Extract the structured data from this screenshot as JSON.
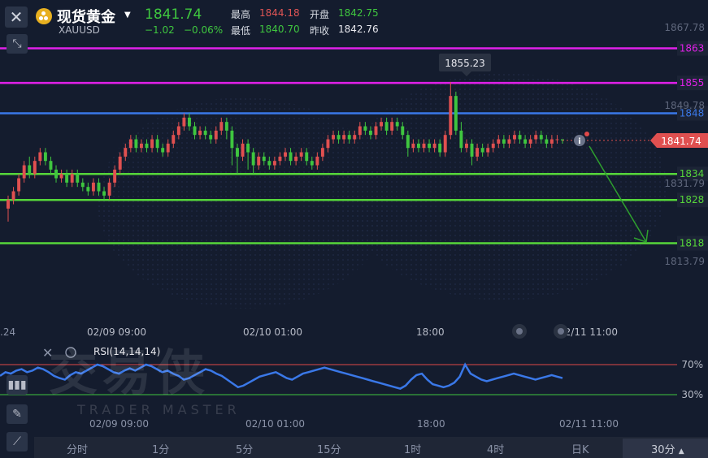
{
  "header": {
    "title": "现货黄金",
    "symbol": "XAUUSD",
    "price": "1841.74",
    "change": "−1.02",
    "change_pct": "−0.06%",
    "high_label": "最高",
    "high_value": "1844.18",
    "low_label": "最低",
    "low_value": "1840.70",
    "open_label": "开盘",
    "open_value": "1842.75",
    "prev_close_label": "昨收",
    "prev_close_value": "1842.76"
  },
  "toolbar": {
    "close_icon": "close-icon",
    "expand_icon": "expand-icon",
    "indicator_icon": "indicator-icon",
    "draw_icon": "pencil-icon",
    "line_icon": "line-tool-icon"
  },
  "watermark": {
    "main": "交易侠",
    "sub": "TRADER MASTER"
  },
  "chart_data": {
    "type": "candlestick",
    "axis_labels": [
      "1867.78",
      "1849.78",
      "1831.79",
      "1813.79"
    ],
    "peak_label": "1855.23",
    "current_price_label": "1841.74",
    "x_labels": [
      "02/09 09:00",
      "02/10 01:00",
      "18:00",
      "02/11 11:00"
    ],
    "left_edge_label": ".24",
    "hlines": [
      {
        "value": 1863,
        "label": "1863",
        "color": "#e020e8"
      },
      {
        "value": 1855,
        "label": "1855",
        "color": "#e020e8"
      },
      {
        "value": 1848,
        "label": "1848",
        "color": "#3a78e8"
      },
      {
        "value": 1834,
        "label": "1834",
        "color": "#56d63a"
      },
      {
        "value": 1828,
        "label": "1828",
        "color": "#56d63a"
      },
      {
        "value": 1818,
        "label": "1818",
        "color": "#56d63a"
      }
    ],
    "candles": [
      [
        1826,
        1828,
        1823,
        1829
      ],
      [
        1828,
        1830,
        1827,
        1831
      ],
      [
        1830,
        1833,
        1829,
        1834
      ],
      [
        1833,
        1836,
        1832,
        1837
      ],
      [
        1836,
        1834,
        1833,
        1838
      ],
      [
        1834,
        1837,
        1833,
        1838
      ],
      [
        1837,
        1839,
        1836,
        1840
      ],
      [
        1839,
        1837,
        1836,
        1840
      ],
      [
        1837,
        1835,
        1834,
        1838
      ],
      [
        1835,
        1833,
        1832,
        1836
      ],
      [
        1833,
        1834,
        1832,
        1835
      ],
      [
        1834,
        1832,
        1831,
        1835
      ],
      [
        1832,
        1834,
        1831,
        1835
      ],
      [
        1834,
        1832,
        1831,
        1835
      ],
      [
        1832,
        1831,
        1830,
        1833
      ],
      [
        1831,
        1830,
        1829,
        1832
      ],
      [
        1830,
        1832,
        1829,
        1833
      ],
      [
        1832,
        1830,
        1829,
        1833
      ],
      [
        1830,
        1829,
        1828,
        1831
      ],
      [
        1829,
        1832,
        1828,
        1833
      ],
      [
        1832,
        1835,
        1831,
        1836
      ],
      [
        1835,
        1838,
        1834,
        1839
      ],
      [
        1838,
        1840,
        1837,
        1841
      ],
      [
        1840,
        1842,
        1839,
        1843
      ],
      [
        1842,
        1840,
        1839,
        1843
      ],
      [
        1840,
        1841,
        1839,
        1842
      ],
      [
        1841,
        1840,
        1839,
        1842
      ],
      [
        1840,
        1842,
        1839,
        1843
      ],
      [
        1842,
        1840,
        1839,
        1843
      ],
      [
        1840,
        1839,
        1838,
        1841
      ],
      [
        1839,
        1841,
        1838,
        1842
      ],
      [
        1841,
        1843,
        1840,
        1844
      ],
      [
        1843,
        1845,
        1842,
        1846
      ],
      [
        1845,
        1847,
        1844,
        1848
      ],
      [
        1847,
        1845,
        1844,
        1848
      ],
      [
        1845,
        1843,
        1842,
        1846
      ],
      [
        1843,
        1844,
        1842,
        1845
      ],
      [
        1844,
        1843,
        1842,
        1845
      ],
      [
        1843,
        1842,
        1841,
        1844
      ],
      [
        1842,
        1844,
        1841,
        1845
      ],
      [
        1844,
        1846,
        1843,
        1847
      ],
      [
        1846,
        1844,
        1842,
        1847
      ],
      [
        1844,
        1840,
        1836,
        1845
      ],
      [
        1840,
        1838,
        1834,
        1841
      ],
      [
        1838,
        1841,
        1837,
        1842
      ],
      [
        1841,
        1839,
        1835,
        1842
      ],
      [
        1839,
        1836,
        1834,
        1840
      ],
      [
        1836,
        1838,
        1835,
        1839
      ],
      [
        1838,
        1837,
        1836,
        1839
      ],
      [
        1837,
        1836,
        1835,
        1838
      ],
      [
        1836,
        1837,
        1835,
        1838
      ],
      [
        1837,
        1838,
        1836,
        1839
      ],
      [
        1838,
        1839,
        1837,
        1840
      ],
      [
        1839,
        1837,
        1836,
        1840
      ],
      [
        1837,
        1838,
        1836,
        1839
      ],
      [
        1838,
        1839,
        1837,
        1840
      ],
      [
        1839,
        1837,
        1836,
        1840
      ],
      [
        1837,
        1836,
        1835,
        1838
      ],
      [
        1836,
        1838,
        1835,
        1839
      ],
      [
        1838,
        1840,
        1837,
        1841
      ],
      [
        1840,
        1842,
        1839,
        1843
      ],
      [
        1842,
        1843,
        1841,
        1844
      ],
      [
        1843,
        1842,
        1841,
        1844
      ],
      [
        1842,
        1843,
        1841,
        1844
      ],
      [
        1843,
        1842,
        1841,
        1844
      ],
      [
        1842,
        1843,
        1841,
        1844
      ],
      [
        1843,
        1845,
        1842,
        1846
      ],
      [
        1845,
        1844,
        1843,
        1846
      ],
      [
        1844,
        1843,
        1842,
        1845
      ],
      [
        1843,
        1845,
        1842,
        1846
      ],
      [
        1845,
        1846,
        1844,
        1847
      ],
      [
        1846,
        1844,
        1843,
        1847
      ],
      [
        1844,
        1846,
        1843,
        1847
      ],
      [
        1846,
        1845,
        1844,
        1847
      ],
      [
        1845,
        1843,
        1842,
        1846
      ],
      [
        1843,
        1840,
        1838,
        1844
      ],
      [
        1840,
        1841,
        1839,
        1842
      ],
      [
        1841,
        1840,
        1839,
        1842
      ],
      [
        1840,
        1841,
        1839,
        1842
      ],
      [
        1841,
        1840,
        1839,
        1842
      ],
      [
        1840,
        1841,
        1839,
        1842
      ],
      [
        1841,
        1839,
        1838,
        1842
      ],
      [
        1839,
        1843,
        1838,
        1844
      ],
      [
        1843,
        1852,
        1842,
        1855.23
      ],
      [
        1852,
        1844,
        1843,
        1853
      ],
      [
        1844,
        1840,
        1839,
        1846
      ],
      [
        1840,
        1841,
        1839,
        1842
      ],
      [
        1841,
        1838,
        1836,
        1842
      ],
      [
        1838,
        1840,
        1837,
        1841
      ],
      [
        1840,
        1839,
        1838,
        1841
      ],
      [
        1839,
        1840,
        1838,
        1841
      ],
      [
        1840,
        1841,
        1839,
        1842
      ],
      [
        1841,
        1842,
        1840,
        1843
      ],
      [
        1842,
        1841,
        1840,
        1843
      ],
      [
        1841,
        1842,
        1840,
        1843
      ],
      [
        1842,
        1843,
        1841,
        1844
      ],
      [
        1843,
        1842,
        1841,
        1844
      ],
      [
        1842,
        1841,
        1840,
        1843
      ],
      [
        1841,
        1842,
        1840,
        1843
      ],
      [
        1842,
        1843,
        1841,
        1844
      ],
      [
        1843,
        1842,
        1841,
        1844
      ],
      [
        1842,
        1841,
        1840,
        1843
      ],
      [
        1841,
        1842,
        1840,
        1843
      ],
      [
        1842,
        1842,
        1841,
        1843
      ],
      [
        1842,
        1841.74,
        1841,
        1842
      ]
    ],
    "rsi": {
      "label": "RSI(14,14,14)",
      "levels": [
        {
          "value": 70,
          "label": "70%",
          "color": "#e04848"
        },
        {
          "value": 30,
          "label": "30%",
          "color": "#3fc63f"
        }
      ],
      "values": [
        55,
        60,
        58,
        62,
        64,
        60,
        62,
        66,
        64,
        60,
        55,
        52,
        50,
        56,
        60,
        58,
        62,
        66,
        70,
        68,
        64,
        60,
        58,
        62,
        65,
        62,
        66,
        70,
        68,
        64,
        60,
        62,
        58,
        55,
        50,
        52,
        56,
        60,
        64,
        62,
        58,
        55,
        50,
        45,
        40,
        42,
        46,
        50,
        54,
        56,
        58,
        60,
        56,
        52,
        50,
        54,
        58,
        60,
        62,
        64,
        66,
        64,
        62,
        60,
        58,
        56,
        54,
        52,
        50,
        48,
        46,
        44,
        42,
        40,
        38,
        42,
        50,
        56,
        58,
        50,
        44,
        42,
        40,
        42,
        46,
        54,
        70,
        58,
        54,
        50,
        48,
        50,
        52,
        54,
        56,
        58,
        56,
        54,
        52,
        50,
        52,
        54,
        56,
        54,
        52
      ]
    }
  },
  "timeframes": [
    "分时",
    "1分",
    "5分",
    "15分",
    "1时",
    "4时",
    "日K",
    "30分"
  ],
  "active_timeframe": "30分"
}
